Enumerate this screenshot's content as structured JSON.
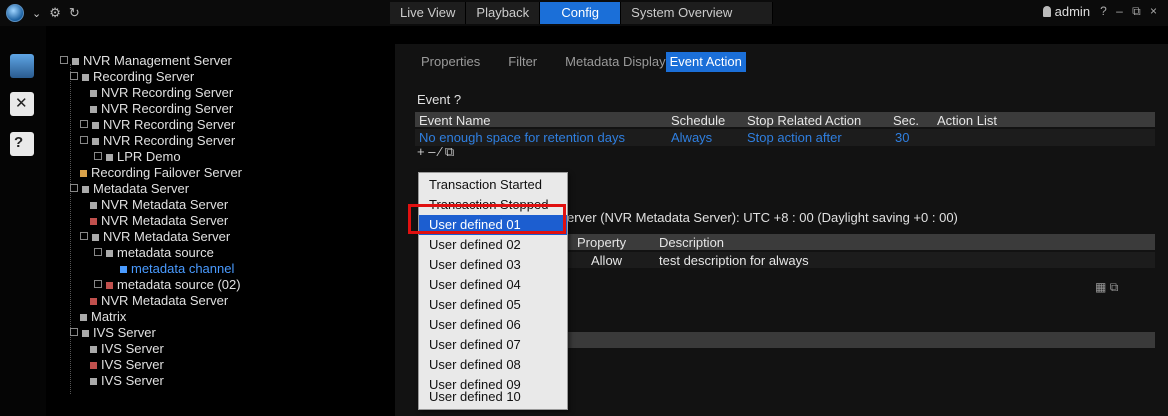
{
  "window": {
    "tabs": [
      {
        "label": "Live View"
      },
      {
        "label": "Playback"
      },
      {
        "label": "Config"
      },
      {
        "label": "System Overview"
      }
    ],
    "user": "admin",
    "controls": "? – ⧉ ×"
  },
  "tree": {
    "nodes": [
      {
        "label": "NVR Management Server"
      },
      {
        "label": "Recording Server"
      },
      {
        "label": "NVR Recording Server"
      },
      {
        "label": "NVR Recording Server"
      },
      {
        "label": "NVR Recording Server"
      },
      {
        "label": "NVR Recording Server"
      },
      {
        "label": "LPR Demo"
      },
      {
        "label": "Recording Failover Server"
      },
      {
        "label": "Metadata Server"
      },
      {
        "label": "NVR Metadata Server"
      },
      {
        "label": "NVR Metadata Server"
      },
      {
        "label": "NVR Metadata Server"
      },
      {
        "label": "metadata source"
      },
      {
        "label": "metadata channel"
      },
      {
        "label": "metadata source (02)"
      },
      {
        "label": "NVR Metadata Server"
      },
      {
        "label": "Matrix"
      },
      {
        "label": "IVS Server"
      },
      {
        "label": "IVS Server"
      },
      {
        "label": "IVS Server"
      },
      {
        "label": "IVS Server"
      }
    ]
  },
  "subtabs": [
    {
      "label": "Properties"
    },
    {
      "label": "Filter"
    },
    {
      "label": "Metadata Display"
    },
    {
      "label": "Event Action"
    }
  ],
  "event": {
    "title": "Event ?",
    "columns": [
      "Event Name",
      "Schedule",
      "Stop Related Action",
      "Sec.",
      "Action List"
    ],
    "row": [
      "No enough space for retention days",
      "Always",
      "Stop action after",
      "30",
      ""
    ]
  },
  "tools": {
    "glyphs": "+ – ∕ ⧉"
  },
  "timezone": {
    "text": "erver (NVR Metadata Server): UTC +8 : 00  (Daylight saving +0 : 00)"
  },
  "props": {
    "columns": [
      "e",
      "Property",
      "Description"
    ],
    "row": [
      "",
      "Allow",
      "test description for always"
    ]
  },
  "dropdown": {
    "items": [
      "Transaction Started",
      "Transaction Stopped",
      "User defined 01",
      "User defined 02",
      "User defined 03",
      "User defined 04",
      "User defined 05",
      "User defined 06",
      "User defined 07",
      "User defined 08",
      "User defined 09",
      "User defined 10"
    ],
    "selected": "User defined 01"
  },
  "colors": {
    "accent": "#1b6fd8",
    "link": "#2f7fe0",
    "highlight": "#e01010"
  }
}
